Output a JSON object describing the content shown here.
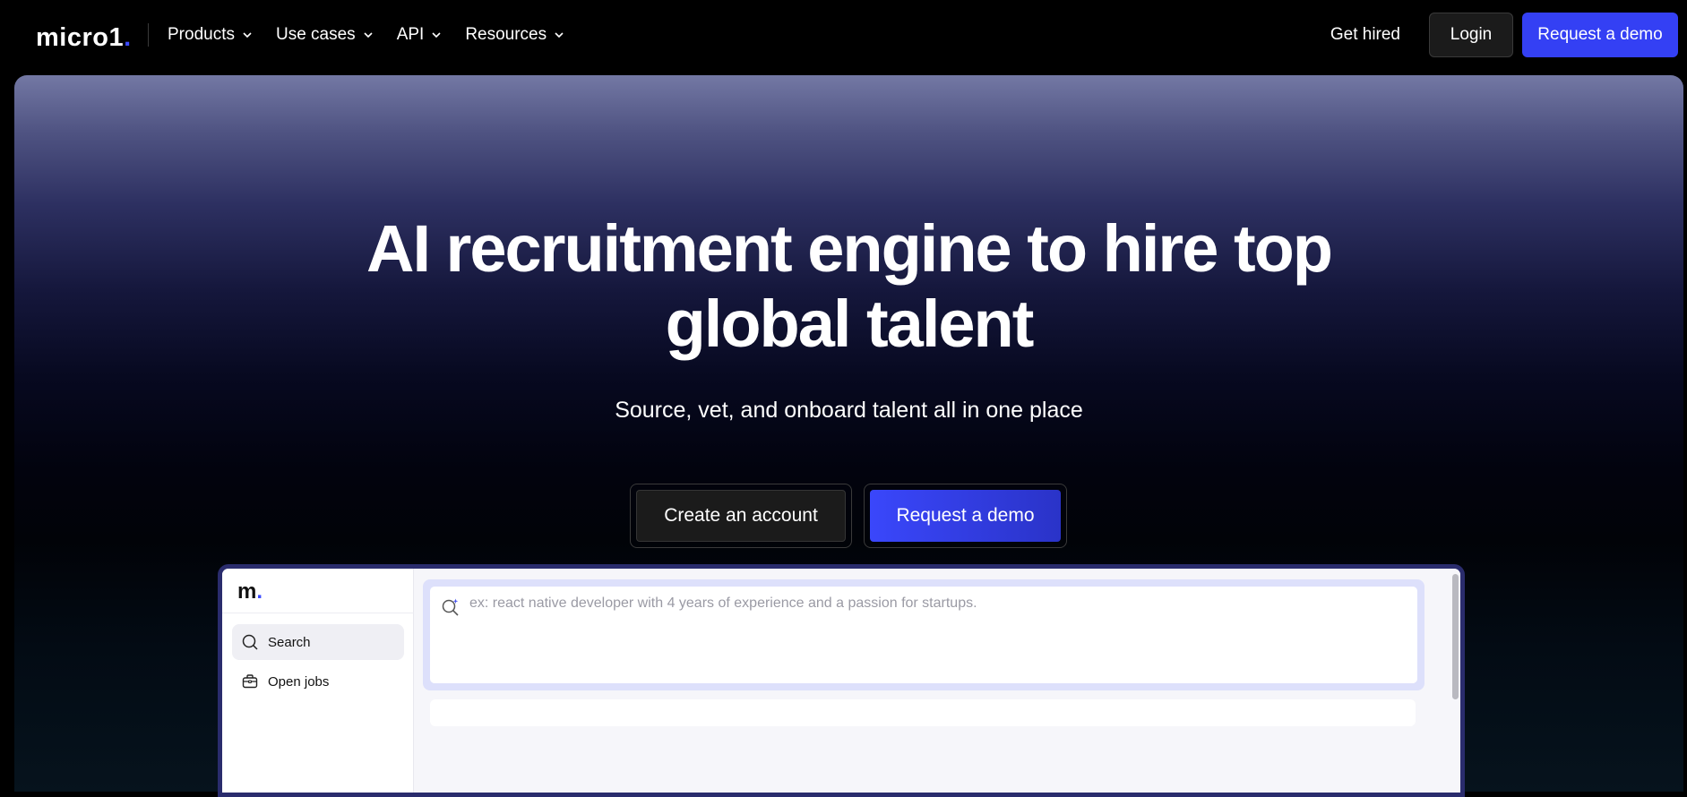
{
  "nav": {
    "logo_text": "micro1",
    "logo_dot": ".",
    "links": [
      {
        "label": "Products"
      },
      {
        "label": "Use cases"
      },
      {
        "label": "API"
      },
      {
        "label": "Resources"
      }
    ],
    "get_hired": "Get hired",
    "login": "Login",
    "request_demo": "Request a demo"
  },
  "hero": {
    "title_line1": "AI recruitment engine to hire top",
    "title_line2": "global talent",
    "subtitle": "Source, vet, and onboard talent all in one place",
    "cta_create": "Create an account",
    "cta_demo": "Request a demo"
  },
  "preview": {
    "logo": "m",
    "logo_dot": ".",
    "sidebar": [
      {
        "label": "Search",
        "icon": "search-icon"
      },
      {
        "label": "Open jobs",
        "icon": "briefcase-icon"
      }
    ],
    "search_placeholder": "ex: react native developer with 4 years of experience and a passion for startups."
  },
  "colors": {
    "accent": "#3440f4",
    "background": "#000000"
  }
}
